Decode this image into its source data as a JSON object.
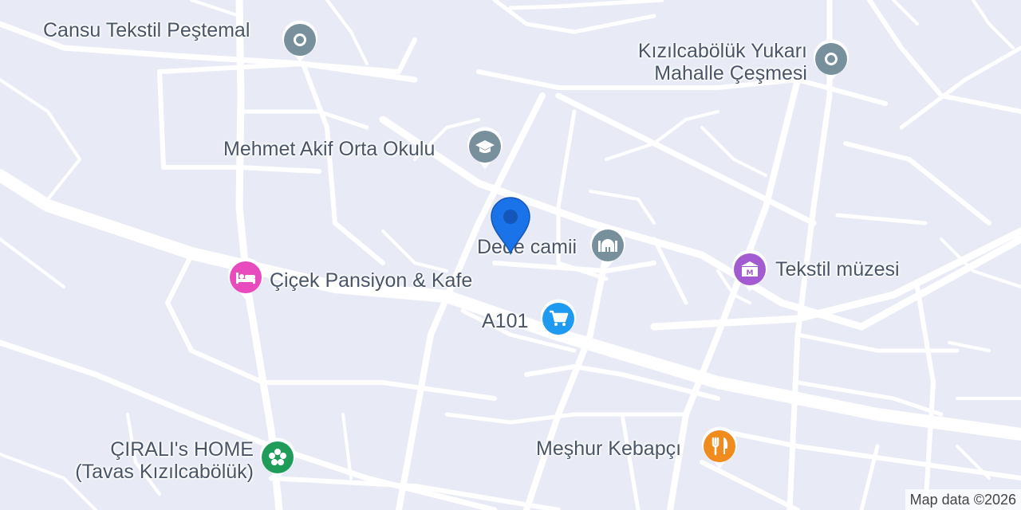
{
  "map": {
    "attribution": "Map data ©2026"
  },
  "pois": [
    {
      "id": "cansu",
      "name_line1": "Cansu Tekstil Peştemal",
      "name_line2": "",
      "icon": "dot-icon",
      "color": "#78909c"
    },
    {
      "id": "kizilcabolu",
      "name_line1": "Kızılcabölük Yukarı",
      "name_line2": "Mahalle Çeşmesi",
      "icon": "dot-icon",
      "color": "#78909c"
    },
    {
      "id": "mehmet",
      "name_line1": "Mehmet Akif Orta Okulu",
      "name_line2": "",
      "icon": "graduation-cap-icon",
      "color": "#78909c"
    },
    {
      "id": "dede",
      "name_line1": "Dede camii",
      "name_line2": "",
      "icon": "mosque-icon",
      "color": "#78909c"
    },
    {
      "id": "tekstil",
      "name_line1": "Tekstil müzesi",
      "name_line2": "",
      "icon": "museum-icon",
      "color": "#a25bd0"
    },
    {
      "id": "cicek",
      "name_line1": "Çiçek Pansiyon & Kafe",
      "name_line2": "",
      "icon": "bed-icon",
      "color": "#e84bbd"
    },
    {
      "id": "a101",
      "name_line1": "A101",
      "name_line2": "",
      "icon": "shopping-cart-icon",
      "color": "#1e9bf0"
    },
    {
      "id": "cirali",
      "name_line1": "ÇIRALI's HOME",
      "name_line2": "(Tavas Kızılcabölük)",
      "icon": "flower-icon",
      "color": "#1f9c5a"
    },
    {
      "id": "meshur",
      "name_line1": "Meşhur Kebapçı",
      "name_line2": "",
      "icon": "fork-knife-icon",
      "color": "#f08c1e"
    }
  ],
  "location_pin": {
    "icon": "location-pin-icon",
    "color": "#1a73e8"
  }
}
